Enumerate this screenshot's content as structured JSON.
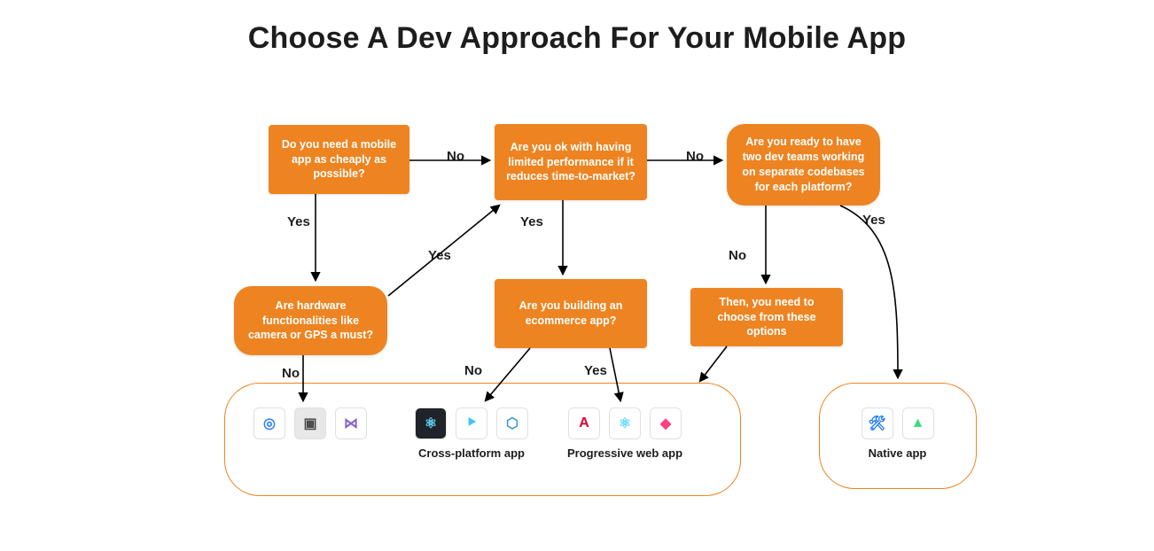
{
  "title": "Choose A Dev Approach For Your Mobile App",
  "nodes": {
    "q_cheap": "Do you need a mobile app as cheaply as possible?",
    "q_hw": "Are hardware functionalities like camera or GPS a must?",
    "q_perf": "Are you ok with having limited performance if it reduces time-to-market?",
    "q_ecom": "Are you building an ecommerce app?",
    "q_teams": "Are you ready to have two dev teams working on separate codebases for each platform?",
    "n_choose": "Then, you need to choose from these options"
  },
  "edges": {
    "cheap_no": "No",
    "cheap_yes": "Yes",
    "hw_yes": "Yes",
    "hw_no": "No",
    "perf_no": "No",
    "perf_yes": "Yes",
    "ecom_no": "No",
    "ecom_yes": "Yes",
    "teams_yes": "Yes",
    "teams_no": "No"
  },
  "outcomes": {
    "cross": "Cross-platform app",
    "pwa": "Progressive web app",
    "native": "Native app"
  },
  "icons": {
    "ionic": {
      "name": "ionic-icon",
      "glyph": "◎",
      "bg": "#ffffff",
      "fg": "#3880ff"
    },
    "cordova": {
      "name": "cordova-icon",
      "glyph": "▣",
      "bg": "#e8e8e8",
      "fg": "#4c4c4c"
    },
    "vs": {
      "name": "visual-studio-icon",
      "glyph": "⋈",
      "bg": "#ffffff",
      "fg": "#8661c5"
    },
    "react": {
      "name": "react-icon",
      "glyph": "⚛",
      "bg": "#20232a",
      "fg": "#61dafb"
    },
    "flutter": {
      "name": "flutter-icon",
      "glyph": "⯈",
      "bg": "#ffffff",
      "fg": "#40c4ff"
    },
    "xamarin": {
      "name": "xamarin-icon",
      "glyph": "⬡",
      "bg": "#ffffff",
      "fg": "#3498db"
    },
    "angular": {
      "name": "angular-icon",
      "glyph": "A",
      "bg": "#ffffff",
      "fg": "#dd0031"
    },
    "react2": {
      "name": "react-icon",
      "glyph": "⚛",
      "bg": "#ffffff",
      "fg": "#61dafb"
    },
    "polymer": {
      "name": "polymer-icon",
      "glyph": "◆",
      "bg": "#ffffff",
      "fg": "#ff4081"
    },
    "xcode": {
      "name": "xcode-icon",
      "glyph": "🛠",
      "bg": "#ffffff",
      "fg": "#1575f9"
    },
    "astudio": {
      "name": "android-studio-icon",
      "glyph": "▲",
      "bg": "#ffffff",
      "fg": "#3ddc84"
    }
  }
}
